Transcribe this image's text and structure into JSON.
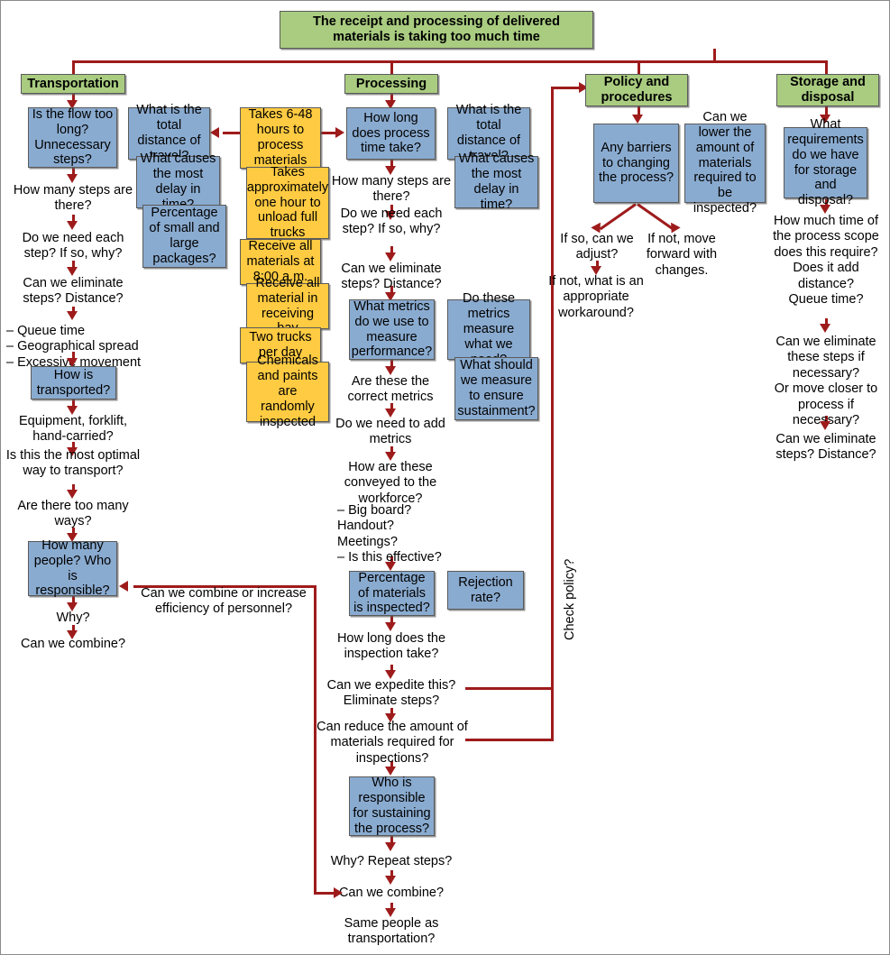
{
  "diagram": {
    "title": "The receipt and processing of delivered materials is taking too much time",
    "colors": {
      "root_fill": "#a9cc80",
      "branch_fill": "#a9cc80",
      "question_fill": "#8aabd0",
      "fact_fill": "#ffcb42",
      "connector": "#9e1b1b",
      "border": "#5a5a5a",
      "canvas": "#ffffff"
    },
    "branches": {
      "transportation": "Transportation",
      "processing": "Processing",
      "policy": "Policy and procedures",
      "storage": "Storage and disposal"
    }
  },
  "transportation": {
    "b1": "Is the flow too long? Unnecessary steps?",
    "t1": "How many steps are there?",
    "t2": "Do we need each step? If so, why?",
    "t3": "Can we eliminate steps? Distance?",
    "t4": "– Queue time\n– Geographical spread\n– Excessive movement",
    "b2": "How is transported?",
    "t5": "Equipment, forklift, hand-carried?",
    "t6": "Is this the most optimal way to transport?",
    "t7": "Are there too many ways?",
    "b3": "How many people? Who is responsible?",
    "t8": "Why?",
    "t9": "Can we combine?",
    "side1": "What is the total distance of travel?",
    "side2": "What causes the most delay in time?",
    "side3": "Percentage of small and large packages?"
  },
  "facts": {
    "f1": "Takes 6-48 hours to process materials",
    "f2": "Takes approximately one hour to unload full trucks",
    "f3": "Receive all materials at 8:00 a.m.",
    "f4": "Receive all material in receiving bay",
    "f5": "Two trucks per day",
    "f6": "Chemicals and paints are randomly inspected"
  },
  "processing": {
    "b1": "How long does process time take?",
    "t1": "How many steps are there?",
    "t2": "Do we need each step? If so, why?",
    "t3": "Can we eliminate steps? Distance?",
    "b2": "What metrics do we use to measure performance?",
    "t4": "Are these the correct metrics",
    "t5": "Do we need to add metrics",
    "t6": "How are these conveyed to the workforce?",
    "t7": "– Big board?\nHandout?\nMeetings?\n– Is this effective?",
    "b3": "Percentage of materials is inspected?",
    "t8": "How long does the inspection take?",
    "t9": "Can we expedite this? Eliminate steps?",
    "t10": "Can reduce the amount of materials required for inspections?",
    "b4": "Who is responsible for sustaining the process?",
    "t11": "Why? Repeat steps?",
    "t12": "Can we combine?",
    "t13": "Same people as transportation?",
    "side1": "What is the total distance of travel?",
    "side2": "What causes the most delay in time?",
    "side3": "Do these metrics measure what we need?",
    "side4": "What should we measure to ensure sustainment?",
    "side5": "Rejection rate?"
  },
  "policy": {
    "b1": "Any barriers to changing the process?",
    "side1": "Can we lower the amount of materials required to be inspected?",
    "t1": "If so, can we adjust?",
    "t2": "If not, move forward with changes.",
    "t3": "If not, what is an appropriate workaround?"
  },
  "storage": {
    "b1": "What requirements do we have for storage and disposal?",
    "t1": "How much time of the process scope does this require?\nDoes it add distance?\nQueue time?",
    "t2": "Can we eliminate these steps if necessary?\nOr move closer to process if necessary?",
    "t3": "Can we eliminate steps? Distance?"
  },
  "links": {
    "personnel": "Can we combine or increase efficiency of personnel?",
    "check_policy": "Check policy?"
  }
}
